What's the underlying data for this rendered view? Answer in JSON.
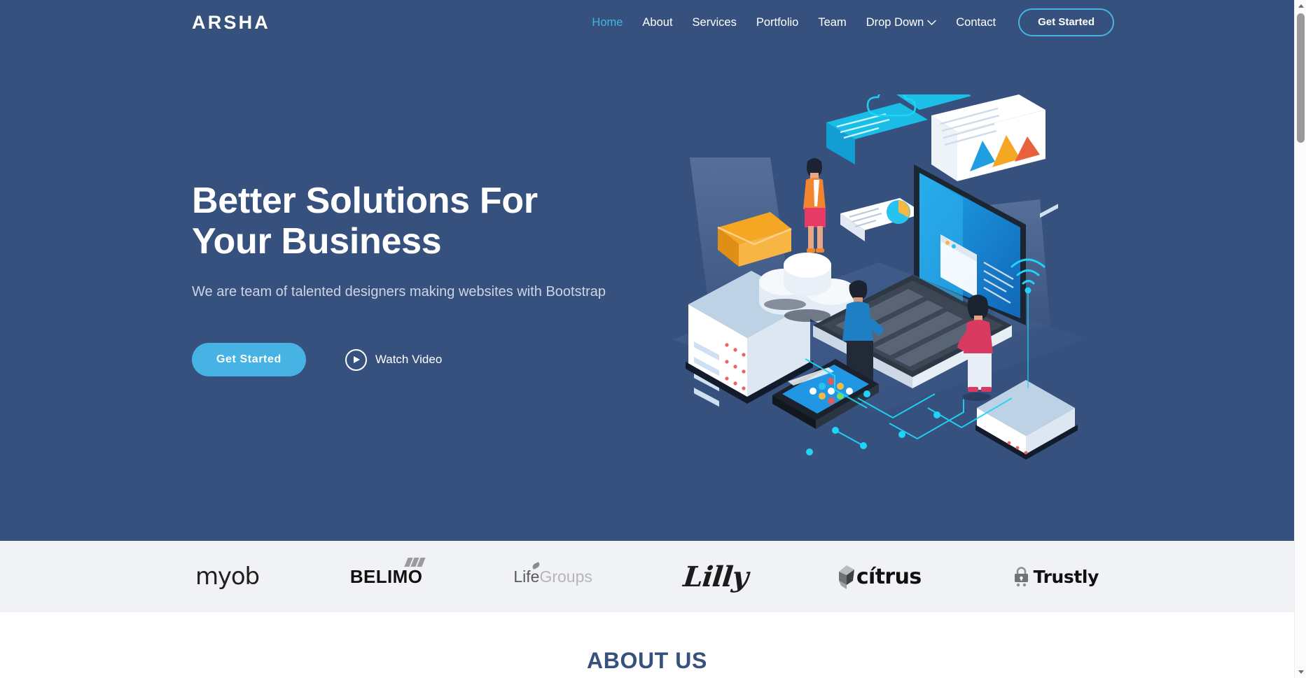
{
  "brand": {
    "logo_text": "ARSHA",
    "accent_color": "#47b2e4",
    "primary_color": "#37517e"
  },
  "nav": {
    "items": [
      {
        "label": "Home",
        "active": true
      },
      {
        "label": "About",
        "active": false
      },
      {
        "label": "Services",
        "active": false
      },
      {
        "label": "Portfolio",
        "active": false
      },
      {
        "label": "Team",
        "active": false
      },
      {
        "label": "Drop Down",
        "active": false,
        "icon": "chevron-down-icon"
      },
      {
        "label": "Contact",
        "active": false
      }
    ],
    "cta_label": "Get Started"
  },
  "hero": {
    "title": "Better Solutions For Your Business",
    "subtitle": "We are team of talented designers making websites with Bootstrap",
    "primary_button": "Get Started",
    "video_button": "Watch Video",
    "video_icon": "play-icon",
    "illustration": "isometric-technology-illustration"
  },
  "clients": {
    "logos": [
      {
        "name": "myob",
        "text": "myob"
      },
      {
        "name": "belimo",
        "text": "BELIMO"
      },
      {
        "name": "lifegroups",
        "text_primary": "Life",
        "text_secondary": "Groups"
      },
      {
        "name": "lilly",
        "text": "Lilly"
      },
      {
        "name": "citrus",
        "text": "cítrus"
      },
      {
        "name": "trustly",
        "text": "Trustly"
      }
    ]
  },
  "about": {
    "title": "ABOUT US"
  },
  "scrollbar": {
    "up_icon": "arrow-up-icon",
    "down_icon": "arrow-down-icon"
  }
}
